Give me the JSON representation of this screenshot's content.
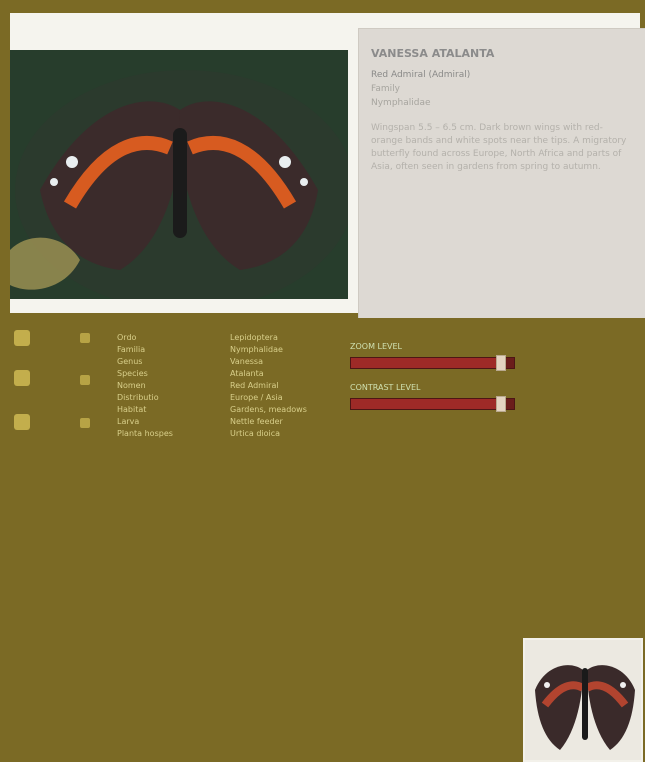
{
  "info": {
    "title": "VANESSA ATALANTA",
    "subtitle": "Red Admiral (Admiral)",
    "line1": "Family",
    "line2": "Nymphalidae",
    "description": "Wingspan 5.5 – 6.5 cm. Dark brown wings with red-orange bands and white spots near the tips. A migratory butterfly found across Europe, North Africa and parts of Asia, often seen in gardens from spring to autumn."
  },
  "sidebar": {
    "col1": [
      "Ordo",
      "Familia",
      "Genus",
      "Species",
      "Nomen",
      "Distributio",
      "Habitat",
      "Larva",
      "Planta hospes"
    ],
    "col2": [
      "Lepidoptera",
      "Nymphalidae",
      "Vanessa",
      "Atalanta",
      "Red Admiral",
      "Europe / Asia",
      "Gardens, meadows",
      "Nettle feeder",
      "Urtica dioica"
    ]
  },
  "sliders": [
    {
      "label": "ZOOM LEVEL",
      "value": 0.92
    },
    {
      "label": "CONTRAST LEVEL",
      "value": 0.92
    }
  ],
  "colors": {
    "frame": "#7b6a25",
    "slider": "#9e2a27",
    "panel": "#ddd9d3"
  }
}
